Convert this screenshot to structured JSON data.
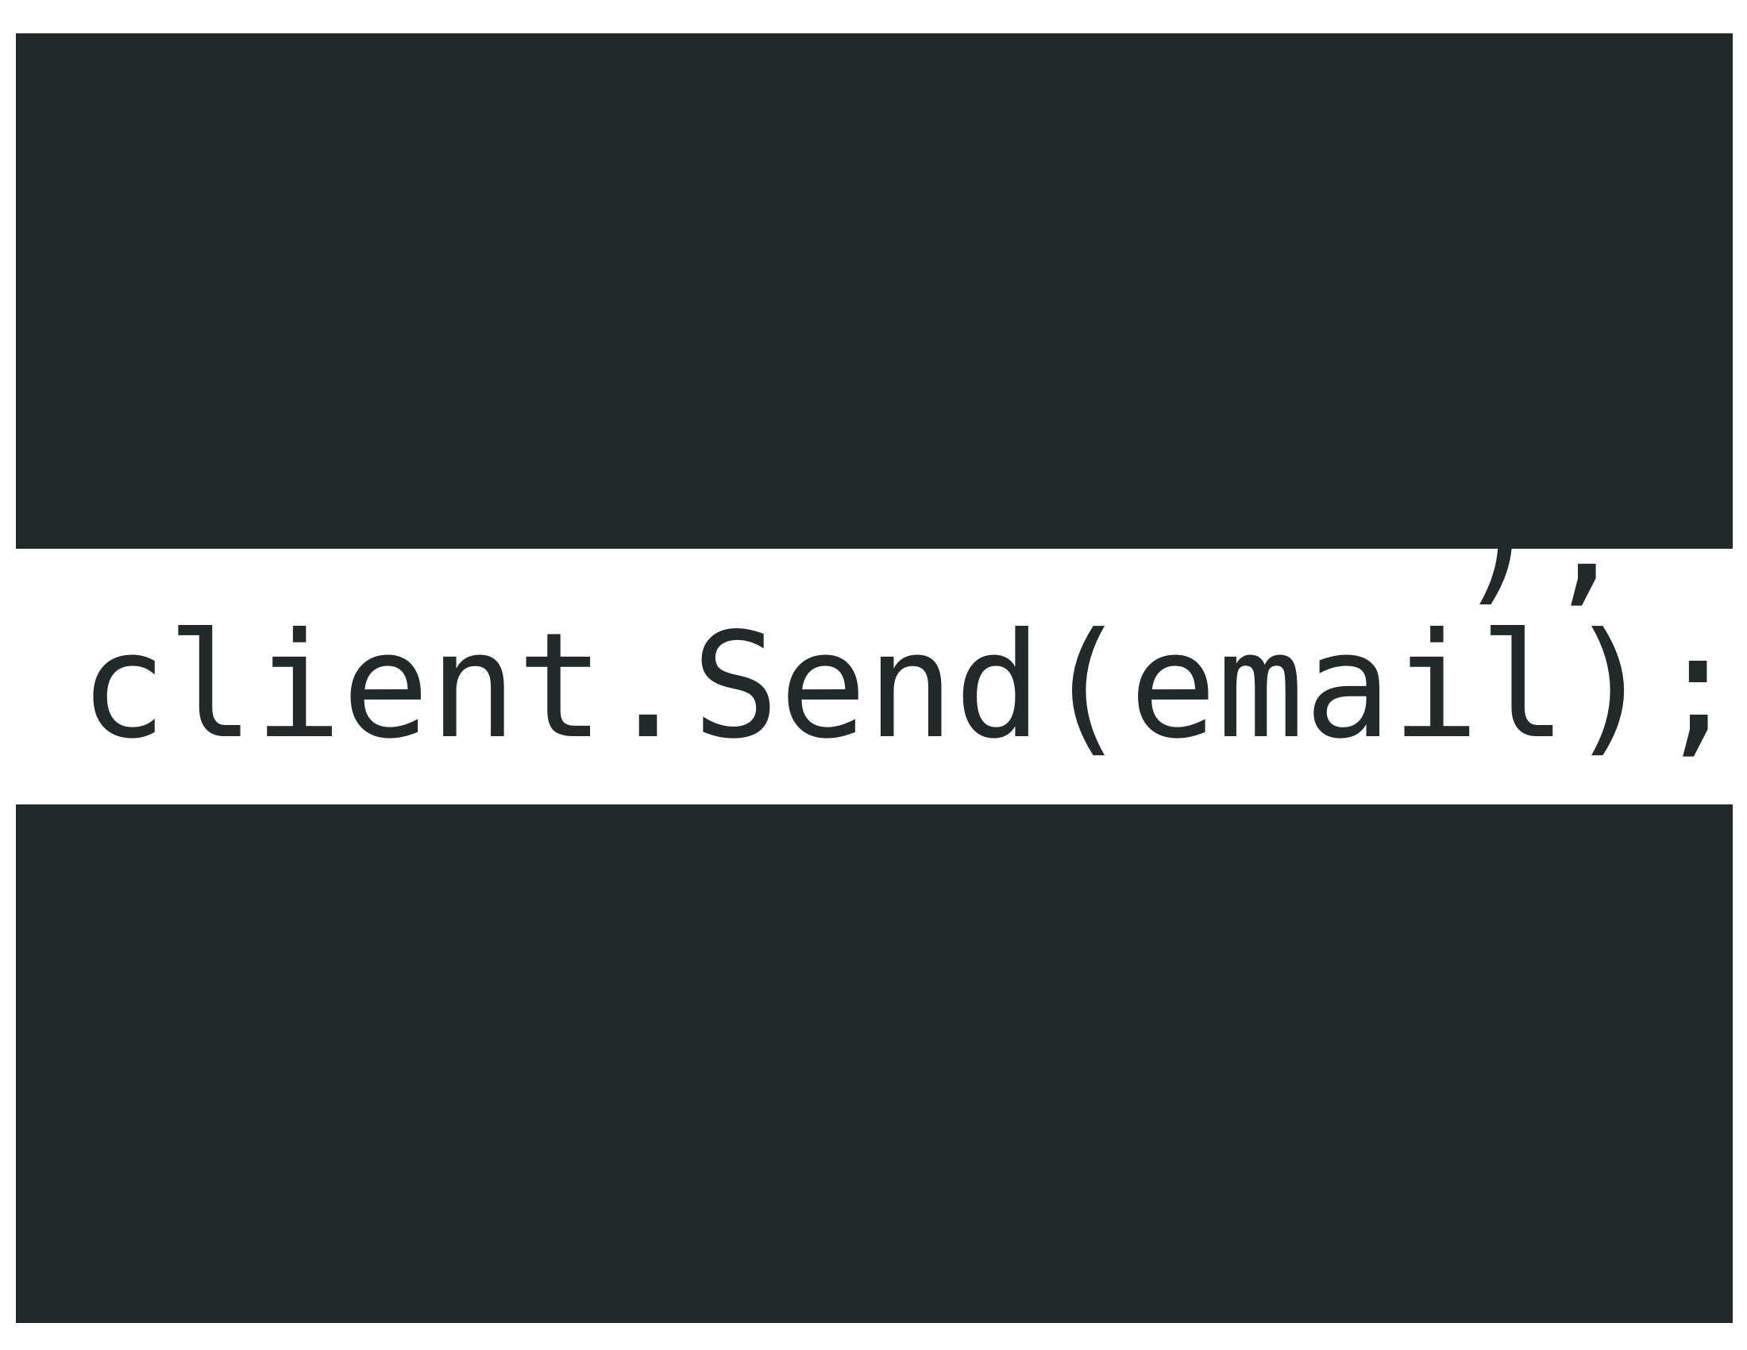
{
  "editor": {
    "previous_line_tail": ");",
    "code_line": "client.Send(email);"
  },
  "colors": {
    "background": "#232829",
    "highlight": "#ffffff",
    "text": "#232829"
  }
}
